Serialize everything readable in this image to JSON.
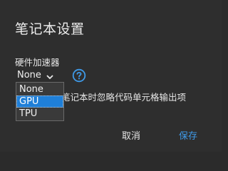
{
  "dialog": {
    "title": "笔记本设置",
    "accelerator_label": "硬件加速器",
    "selected_accelerator": "None",
    "checkbox_text": "笔记本时忽略代码单元格输出项",
    "options": [
      "None",
      "GPU",
      "TPU"
    ],
    "highlighted_option": "GPU",
    "cancel_label": "取消",
    "save_label": "保存",
    "help_icon": "help-circle-icon",
    "accent_color": "#3f9ae8",
    "highlight_color": "#1f7fd8"
  }
}
